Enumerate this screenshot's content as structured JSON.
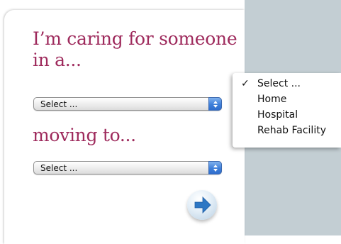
{
  "form": {
    "heading_caring": "I’m caring for someone in a...",
    "heading_moving": "moving to...",
    "select_from": {
      "value": "Select ..."
    },
    "select_to": {
      "value": "Select ..."
    },
    "go_button": {
      "icon": "arrow-right-icon"
    }
  },
  "dropdown_menu": {
    "checkmark": "✓",
    "items": [
      {
        "label": "Select ...",
        "selected": true
      },
      {
        "label": "Home",
        "selected": false
      },
      {
        "label": "Hospital",
        "selected": false
      },
      {
        "label": "Rehab Facility",
        "selected": false
      }
    ]
  },
  "colors": {
    "heading": "#9e2a5c",
    "side_panel": "#c3ced3",
    "stepper": "#3f7fd9",
    "arrow": "#2d77c4"
  }
}
